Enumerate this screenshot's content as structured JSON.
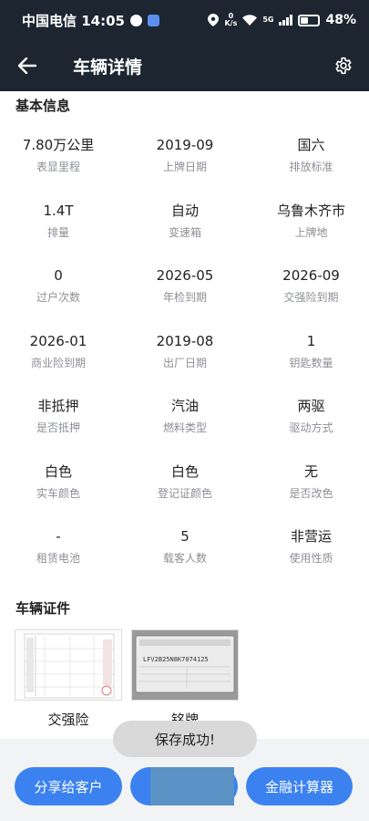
{
  "status_bar": {
    "carrier_time": "中国电信 14:05",
    "network_speed": "0\nK/s",
    "network_type": "5G",
    "battery": "48%"
  },
  "header": {
    "title": "车辆详情"
  },
  "basic_info": {
    "title": "基本信息",
    "items": [
      {
        "value": "7.80万公里",
        "label": "表显里程"
      },
      {
        "value": "2019-09",
        "label": "上牌日期"
      },
      {
        "value": "国六",
        "label": "排放标准"
      },
      {
        "value": "1.4T",
        "label": "排量"
      },
      {
        "value": "自动",
        "label": "变速箱"
      },
      {
        "value": "乌鲁木齐市",
        "label": "上牌地"
      },
      {
        "value": "0",
        "label": "过户次数"
      },
      {
        "value": "2026-05",
        "label": "年检到期"
      },
      {
        "value": "2026-09",
        "label": "交强险到期"
      },
      {
        "value": "2026-01",
        "label": "商业险到期"
      },
      {
        "value": "2019-08",
        "label": "出厂日期"
      },
      {
        "value": "1",
        "label": "钥匙数量"
      },
      {
        "value": "非抵押",
        "label": "是否抵押"
      },
      {
        "value": "汽油",
        "label": "燃料类型"
      },
      {
        "value": "两驱",
        "label": "驱动方式"
      },
      {
        "value": "白色",
        "label": "实车颜色"
      },
      {
        "value": "白色",
        "label": "登记证颜色"
      },
      {
        "value": "无",
        "label": "是否改色"
      },
      {
        "value": "-",
        "label": "租赁电池"
      },
      {
        "value": "5",
        "label": "载客人数"
      },
      {
        "value": "非营运",
        "label": "使用性质"
      }
    ]
  },
  "documents": {
    "title": "车辆证件",
    "items": [
      {
        "label": "交强险"
      },
      {
        "label": "铭牌",
        "plate_text": "LFV2B25N8K7074125"
      }
    ]
  },
  "toast": "保存成功!",
  "actions": {
    "share_label": "分享给客户",
    "middle_label": "",
    "calc_label": "金融计算器"
  },
  "colors": {
    "header_bg": "#1c2530",
    "primary": "#3b82f0",
    "label_gray": "#8d8f94"
  }
}
